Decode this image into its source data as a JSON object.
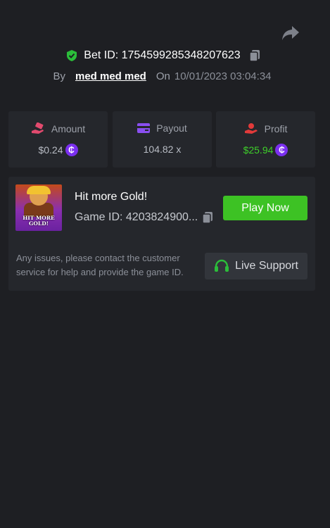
{
  "header": {
    "bet_id_label": "Bet ID: 1754599285348207623",
    "by_label": "By",
    "username": "med med med",
    "on_label": "On",
    "date": "10/01/2023 03:04:34"
  },
  "stats": {
    "amount": {
      "label": "Amount",
      "value": "$0.24"
    },
    "payout": {
      "label": "Payout",
      "value": "104.82 x"
    },
    "profit": {
      "label": "Profit",
      "value": "$25.94"
    },
    "coin_symbol": "₵"
  },
  "game": {
    "thumbnail_text": "HIT MORE GOLD!",
    "title": "Hit more Gold!",
    "game_id_label": "Game ID: 4203824900...",
    "play_label": "Play Now"
  },
  "support": {
    "help_text": "Any issues, please contact the customer service for help and provide the game ID.",
    "button_label": "Live Support"
  },
  "colors": {
    "background": "#1e1f23",
    "card": "#25272c",
    "accent_green": "#3dc224",
    "coin_purple": "#7b2ff0",
    "profit_green": "#3ed02a"
  },
  "icons": [
    "share-icon",
    "shield-check-icon",
    "copy-icon",
    "money-hand-icon",
    "card-icon",
    "profit-hand-icon",
    "coin-icon",
    "headset-icon"
  ]
}
